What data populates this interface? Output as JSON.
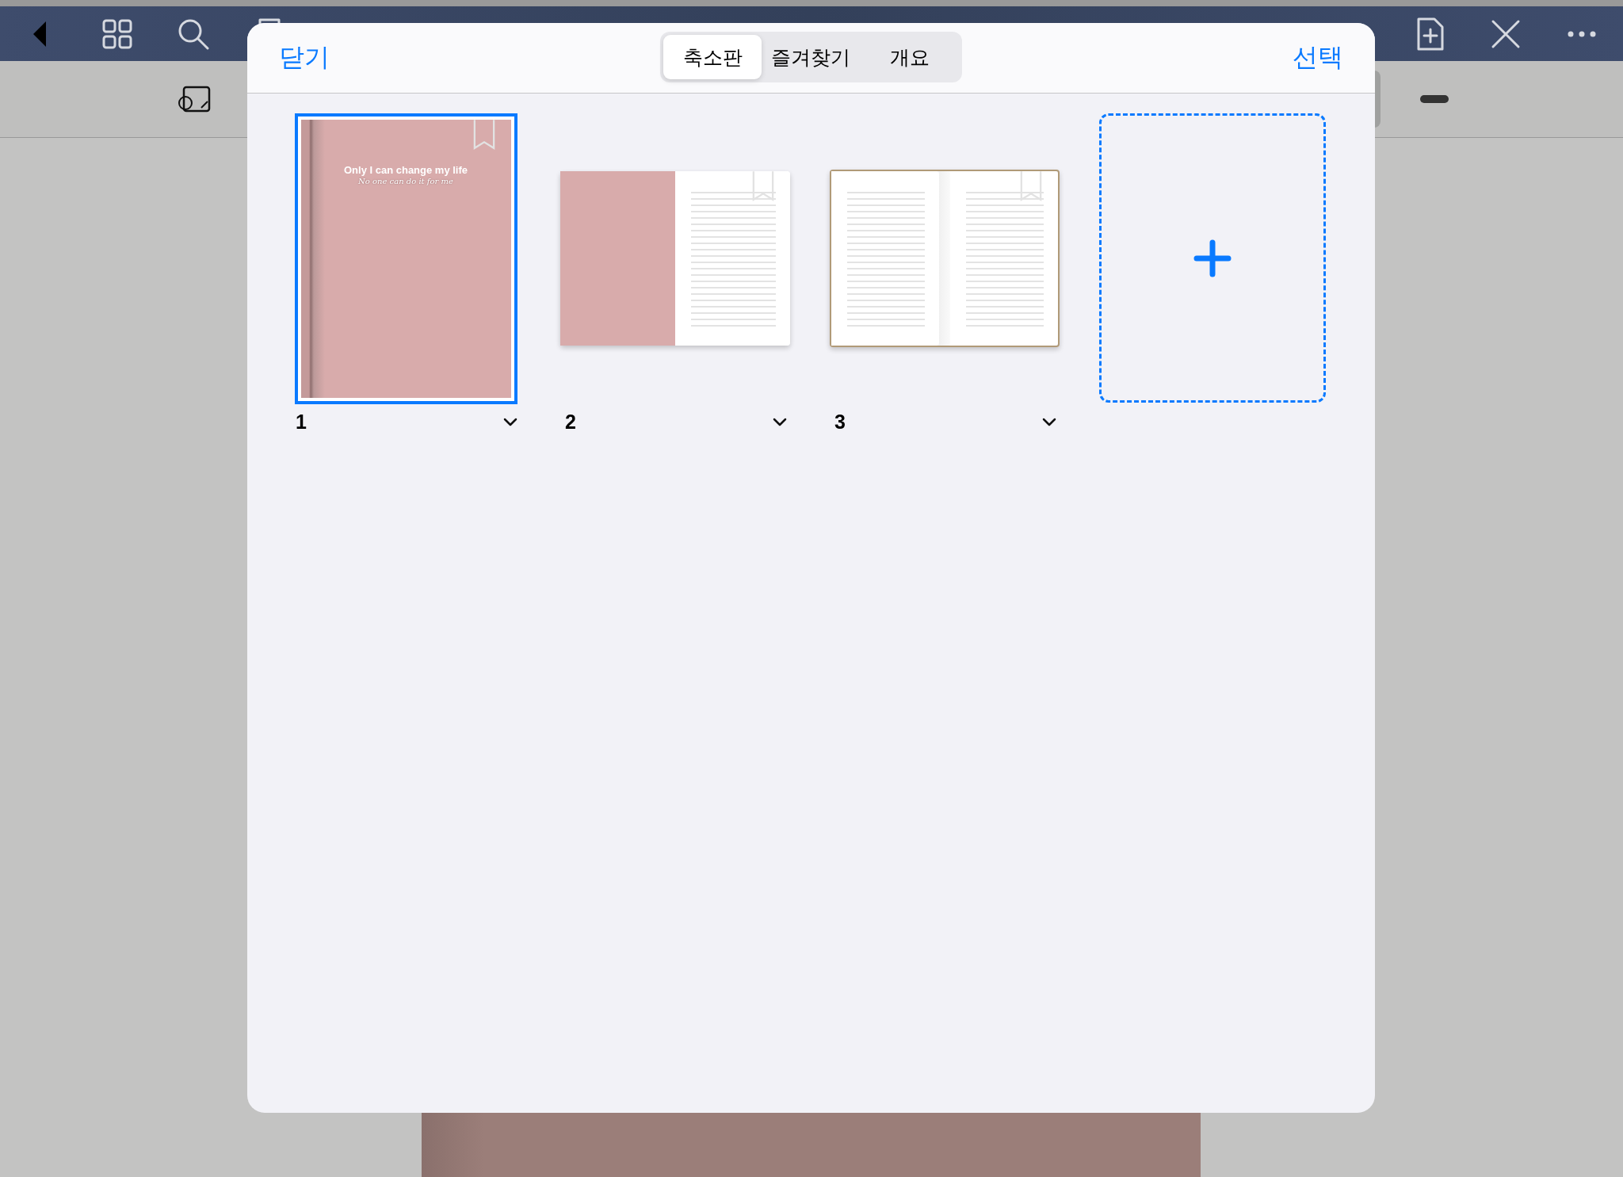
{
  "modal": {
    "close_label": "닫기",
    "select_label": "선택",
    "tabs": [
      {
        "label": "축소판",
        "selected": true
      },
      {
        "label": "즐겨찾기",
        "selected": false
      },
      {
        "label": "개요",
        "selected": false
      }
    ],
    "pages": [
      {
        "number": "1",
        "kind": "cover",
        "selected": true,
        "title": "Only I can change my life",
        "subtitle": "No one can do it for me"
      },
      {
        "number": "2",
        "kind": "cover-spread",
        "selected": false
      },
      {
        "number": "3",
        "kind": "lined-spread",
        "selected": false
      }
    ]
  }
}
